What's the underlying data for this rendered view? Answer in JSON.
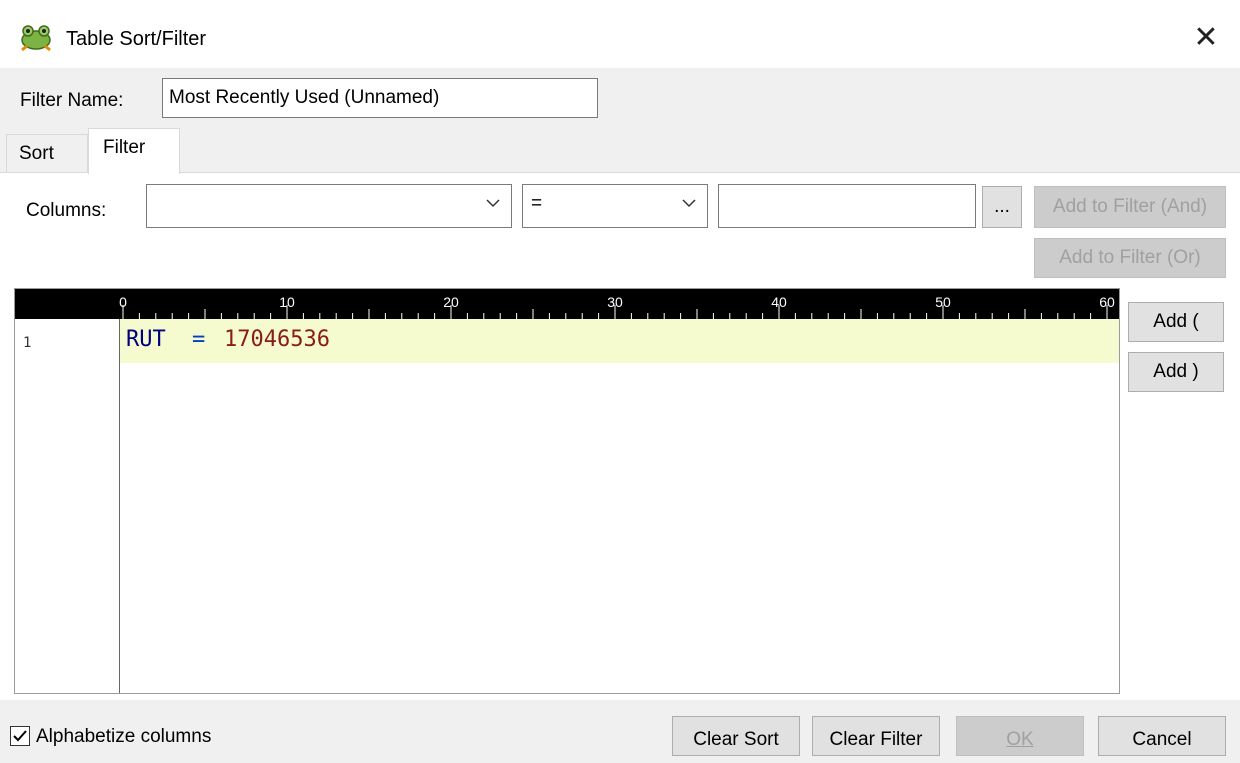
{
  "window": {
    "title": "Table Sort/Filter",
    "close_glyph": "✕"
  },
  "filter_name": {
    "label": "Filter Name:",
    "value": "Most Recently Used (Unnamed)"
  },
  "tabs": [
    {
      "label": "Sort",
      "active": false
    },
    {
      "label": "Filter",
      "active": true
    }
  ],
  "filter_panel": {
    "columns_label": "Columns:",
    "column_select_value": "",
    "operator_select_value": "=",
    "value_input": "",
    "ellipsis_label": "...",
    "add_and_label": "Add to Filter (And)",
    "add_or_label": "Add to Filter (Or)",
    "add_open_paren_label": "Add  (",
    "add_close_paren_label": "Add  )"
  },
  "editor": {
    "ruler_marks": [
      "0",
      "10",
      "20",
      "30",
      "40",
      "50",
      "60"
    ],
    "lines": [
      {
        "number": "1",
        "tokens": [
          {
            "text": "RUT",
            "kind": "ident"
          },
          {
            "text": "=",
            "kind": "op"
          },
          {
            "text": "17046536",
            "kind": "num"
          }
        ]
      }
    ],
    "highlight_color": "#f5fbcf"
  },
  "footer": {
    "alphabetize_label": "Alphabetize columns",
    "alphabetize_checked": true,
    "clear_sort_label": "Clear Sort",
    "clear_filter_label": "Clear Filter",
    "ok_label": "OK",
    "cancel_label": "Cancel"
  },
  "icons": {
    "app": "frog-icon",
    "close": "close-icon",
    "dropdown": "chevron-down-icon",
    "checkbox": "checkmark-icon"
  }
}
